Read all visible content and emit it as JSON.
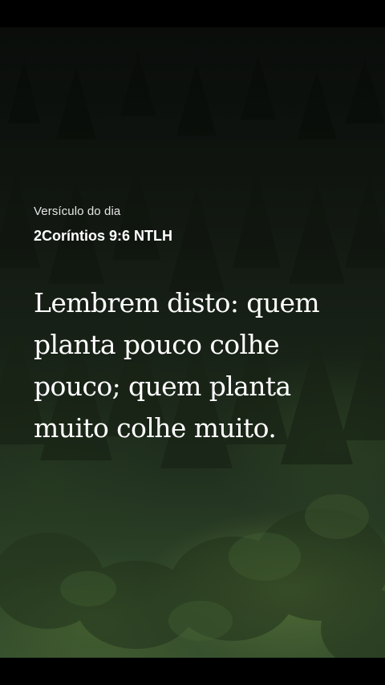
{
  "verse_card": {
    "label": "Versículo do dia",
    "reference": "2Coríntios 9:6 NTLH",
    "text": "Lembrem disto: quem planta pouco colhe pouco; quem planta muito colhe muito."
  },
  "colors": {
    "background": "#000000",
    "text_primary": "#ffffff",
    "text_secondary": "#e6e6e6",
    "forest_dark": "#141b14",
    "forest_light": "#3a5530"
  }
}
